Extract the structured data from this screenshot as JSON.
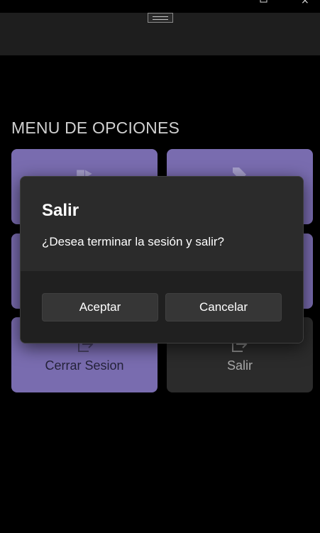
{
  "window": {
    "maximize_icon": "maximize-icon",
    "close_glyph": "×"
  },
  "menu": {
    "title": "MENU DE OPCIONES",
    "tiles": [
      {
        "label": "",
        "icon": "flow-icon",
        "style": "accent"
      },
      {
        "label": "",
        "icon": "tag-icon",
        "style": "accent"
      },
      {
        "label": "",
        "icon": "",
        "style": "accent"
      },
      {
        "label": "",
        "icon": "",
        "style": "accent"
      },
      {
        "label": "Cerrar Sesion",
        "icon": "logout-icon",
        "style": "accent"
      },
      {
        "label": "Salir",
        "icon": "exit-icon",
        "style": "dark"
      }
    ]
  },
  "dialog": {
    "title": "Salir",
    "message": "¿Desea terminar la sesión y salir?",
    "accept_label": "Aceptar",
    "cancel_label": "Cancelar"
  },
  "colors": {
    "accent": "#796caf",
    "dark_tile": "#2b2b2b",
    "dialog_bg": "#2b2b2b",
    "dialog_footer": "#202020",
    "background": "#000000"
  }
}
